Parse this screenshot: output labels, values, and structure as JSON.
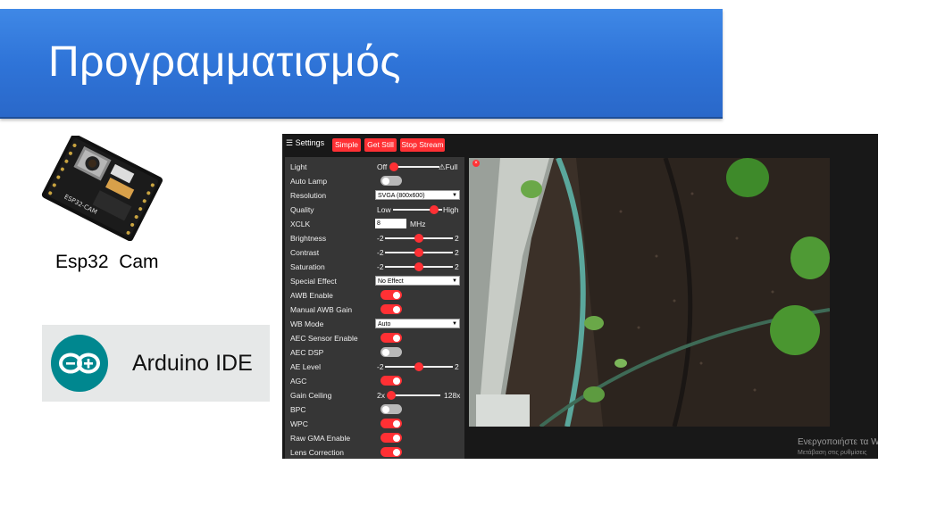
{
  "slide": {
    "title": "Προγραμματισμός",
    "board_label": "Esp32  Cam",
    "arduino_label": "Arduino IDE"
  },
  "colors": {
    "title_bar": "#2f74d8",
    "accent": "#ff3034",
    "panel_bg": "#363636",
    "app_bg": "#181818"
  },
  "app": {
    "menu_label": "☰ Settings",
    "buttons": {
      "simple": "Simple",
      "get_still": "Get Still",
      "stop_stream": "Stop Stream"
    },
    "light": {
      "label": "Light",
      "min": "Off",
      "max": "⚠Full",
      "value": 0
    },
    "auto_lamp": {
      "label": "Auto Lamp",
      "on": false
    },
    "resolution": {
      "label": "Resolution",
      "value": "SVGA (800x600)"
    },
    "quality": {
      "label": "Quality",
      "min": "Low",
      "max": "High",
      "value": 0.85
    },
    "xclk": {
      "label": "XCLK",
      "value": "8",
      "unit": "MHz"
    },
    "brightness": {
      "label": "Brightness",
      "min": "-2",
      "max": "2",
      "value": 0
    },
    "contrast": {
      "label": "Contrast",
      "min": "-2",
      "max": "2",
      "value": 0
    },
    "saturation": {
      "label": "Saturation",
      "min": "-2",
      "max": "2",
      "value": 0
    },
    "special_effect": {
      "label": "Special Effect",
      "value": "No Effect"
    },
    "awb_enable": {
      "label": "AWB Enable",
      "on": true
    },
    "manual_awb_gain": {
      "label": "Manual AWB Gain",
      "on": true
    },
    "wb_mode": {
      "label": "WB Mode",
      "value": "Auto"
    },
    "aec_sensor": {
      "label": "AEC Sensor Enable",
      "on": true
    },
    "aec_dsp": {
      "label": "AEC DSP",
      "on": false
    },
    "ae_level": {
      "label": "AE Level",
      "min": "-2",
      "max": "2",
      "value": 0
    },
    "agc": {
      "label": "AGC",
      "on": true
    },
    "gain_ceiling": {
      "label": "Gain Ceiling",
      "min": "2x",
      "max": "128x",
      "value": 0
    },
    "bpc": {
      "label": "BPC",
      "on": false
    },
    "wpc": {
      "label": "WPC",
      "on": true
    },
    "raw_gma": {
      "label": "Raw GMA Enable",
      "on": true
    },
    "lens_correction": {
      "label": "Lens Correction",
      "on": true
    },
    "watermark_line1": "Ενεργοποιήστε τα W",
    "watermark_line2": "Μετάβαση στις ρυθμίσεις"
  }
}
